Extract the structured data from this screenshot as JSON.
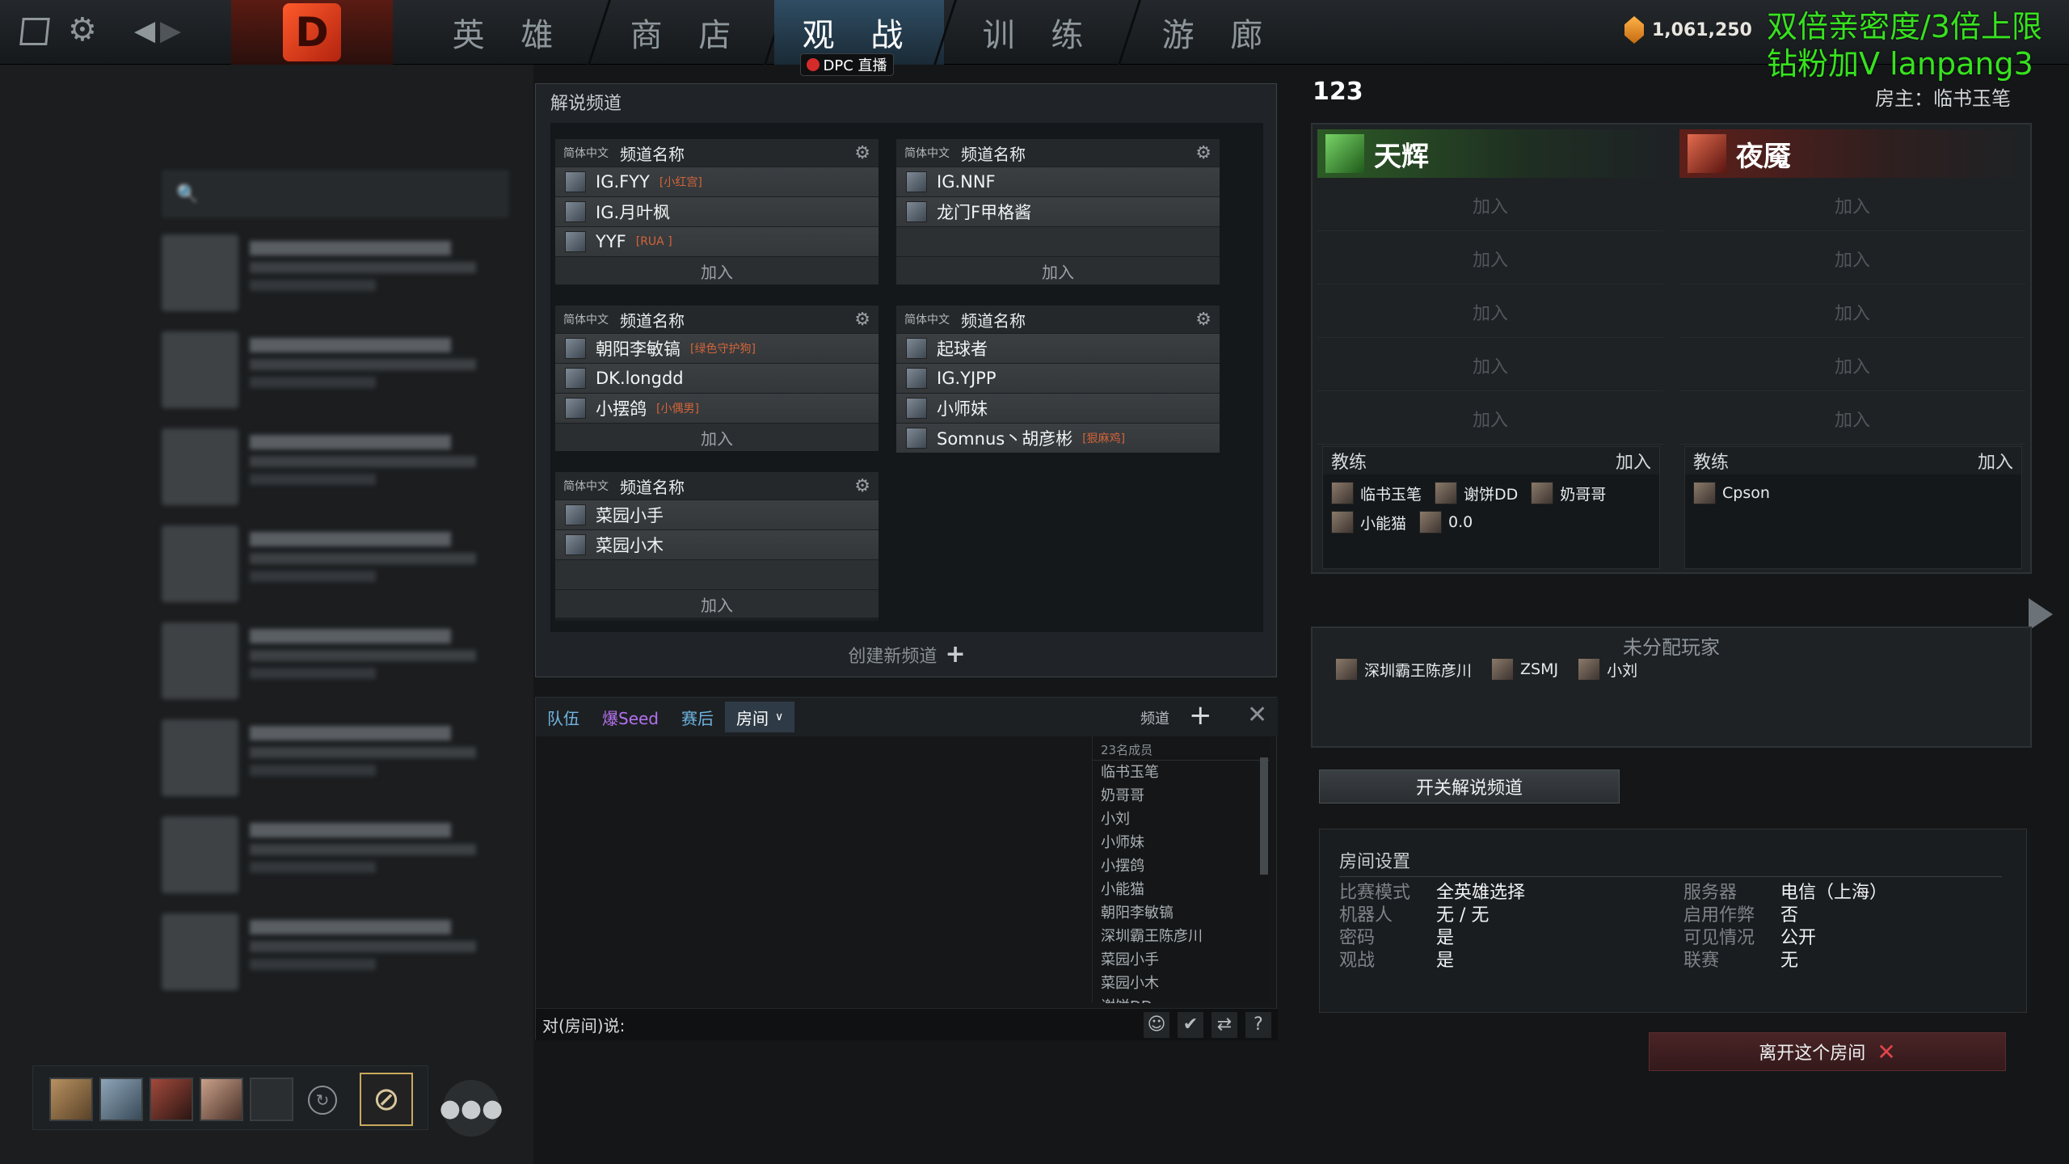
{
  "topbar": {
    "tabs": [
      "英 雄",
      "商 店",
      "观 战",
      "训 练",
      "游 廊"
    ],
    "dpc_label": "DPC 直播",
    "gold": "1,061,250",
    "promo_line1": "双倍亲密度/3倍上限",
    "promo_line2": "钻粉加V lanpang3"
  },
  "caster_window": {
    "title": "解说频道",
    "channels": [
      {
        "lang": "简体中文",
        "name": "频道名称",
        "members": [
          {
            "name": "IG.FYY",
            "tag": "[小红宫]"
          },
          {
            "name": "IG.月叶枫",
            "tag": ""
          },
          {
            "name": "YYF",
            "tag": "[RUA ]"
          }
        ],
        "join": "加入"
      },
      {
        "lang": "简体中文",
        "name": "频道名称",
        "members": [
          {
            "name": "IG.NNF",
            "tag": ""
          },
          {
            "name": "龙门F甲格酱",
            "tag": ""
          }
        ],
        "join": "加入"
      },
      {
        "lang": "简体中文",
        "name": "频道名称",
        "members": [
          {
            "name": "朝阳李敏镐",
            "tag": "[绿色守护狗]"
          },
          {
            "name": "DK.longdd",
            "tag": ""
          },
          {
            "name": "小摆鸽",
            "tag": "[小偶男]"
          }
        ],
        "join": "加入"
      },
      {
        "lang": "简体中文",
        "name": "频道名称",
        "members": [
          {
            "name": "起球者",
            "tag": ""
          },
          {
            "name": "IG.YJPP",
            "tag": ""
          },
          {
            "name": "小师妹",
            "tag": ""
          },
          {
            "name": "Somnus丶胡彦彬",
            "tag": "[狠麻鸡]"
          }
        ],
        "join": ""
      },
      {
        "lang": "简体中文",
        "name": "频道名称",
        "members": [
          {
            "name": "菜园小手",
            "tag": ""
          },
          {
            "name": "菜园小木",
            "tag": ""
          }
        ],
        "join": "加入"
      }
    ],
    "create_new": "创建新频道"
  },
  "chat": {
    "tabs": [
      "队伍",
      "爆Seed",
      "赛后",
      "房间"
    ],
    "channel_label": "频道",
    "member_count": "23名成员",
    "members": [
      "临书玉笔",
      "奶哥哥",
      "小刘",
      "小师妹",
      "小摆鸽",
      "小能猫",
      "朝阳李敏镐",
      "深圳霸王陈彦川",
      "菜园小手",
      "菜园小木",
      "谢饼DD"
    ],
    "input_label": "对(房间)说:"
  },
  "lobby": {
    "name": "123",
    "host": "房主：临书玉笔",
    "radiant": {
      "name": "天辉",
      "slots": [
        "加入",
        "加入",
        "加入",
        "加入",
        "加入"
      ]
    },
    "dire": {
      "name": "夜魇",
      "slots": [
        "加入",
        "加入",
        "加入",
        "加入",
        "加入"
      ]
    },
    "coach_label": "教练",
    "coach_join": "加入",
    "radiant_coaches": [
      "临书玉笔",
      "谢饼DD",
      "奶哥哥",
      "小能猫",
      "0.0"
    ],
    "dire_coaches": [
      "Cpson"
    ],
    "unassigned_title": "未分配玩家",
    "unassigned": [
      "深圳霸王陈彦川",
      "ZSMJ",
      "小刘"
    ],
    "caster_toggle": "开关解说频道",
    "leave": "离开这个房间"
  },
  "settings": {
    "title": "房间设置",
    "rows": [
      {
        "k": "比赛模式",
        "v": "全英雄选择"
      },
      {
        "k": "机器人",
        "v": "无 / 无"
      },
      {
        "k": "密码",
        "v": "是"
      },
      {
        "k": "观战",
        "v": "是"
      },
      {
        "k": "服务器",
        "v": "电信（上海）"
      },
      {
        "k": "启用作弊",
        "v": "否"
      },
      {
        "k": "可见情况",
        "v": "公开"
      },
      {
        "k": "联赛",
        "v": "无"
      }
    ]
  }
}
